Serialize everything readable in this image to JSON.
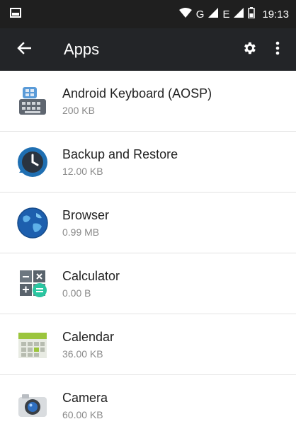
{
  "status_bar": {
    "network": "G",
    "network2": "E",
    "time": "19:13",
    "icons": [
      "notification-icon",
      "wifi-icon",
      "signal-icon",
      "signal-icon",
      "battery-icon"
    ]
  },
  "app_bar": {
    "title": "Apps",
    "icons": [
      "back-arrow-icon",
      "gear-icon",
      "overflow-menu-icon"
    ]
  },
  "apps": [
    {
      "name": "Android Keyboard (AOSP)",
      "size": "200 KB",
      "icon": "keyboard-icon"
    },
    {
      "name": "Backup and Restore",
      "size": "12.00 KB",
      "icon": "backup-restore-icon"
    },
    {
      "name": "Browser",
      "size": "0.99 MB",
      "icon": "browser-globe-icon"
    },
    {
      "name": "Calculator",
      "size": "0.00 B",
      "icon": "calculator-icon"
    },
    {
      "name": "Calendar",
      "size": "36.00 KB",
      "icon": "calendar-icon"
    },
    {
      "name": "Camera",
      "size": "60.00 KB",
      "icon": "camera-icon"
    }
  ],
  "colors": {
    "app_bar": "#232528",
    "status_bar": "#1f1f1f",
    "divider": "#e3e3e3",
    "secondary_text": "#8a8a8a"
  }
}
